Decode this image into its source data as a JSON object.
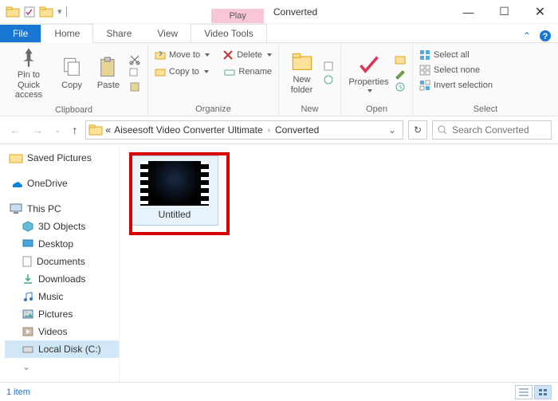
{
  "window": {
    "title": "Converted",
    "contextual_tab": "Play"
  },
  "tabs": {
    "file": "File",
    "home": "Home",
    "share": "Share",
    "view": "View",
    "video_tools": "Video Tools"
  },
  "ribbon": {
    "clipboard": {
      "pin": "Pin to Quick\naccess",
      "copy": "Copy",
      "paste": "Paste",
      "label": "Clipboard"
    },
    "organize": {
      "move": "Move to",
      "copyto": "Copy to",
      "delete": "Delete",
      "rename": "Rename",
      "label": "Organize"
    },
    "new": {
      "newfolder": "New\nfolder",
      "label": "New"
    },
    "open": {
      "properties": "Properties",
      "label": "Open"
    },
    "select": {
      "all": "Select all",
      "none": "Select none",
      "invert": "Invert selection",
      "label": "Select"
    }
  },
  "address": {
    "prefix": "«",
    "crumb1": "Aiseesoft Video Converter Ultimate",
    "crumb2": "Converted"
  },
  "search": {
    "placeholder": "Search Converted"
  },
  "nav": {
    "saved": "Saved Pictures",
    "onedrive": "OneDrive",
    "thispc": "This PC",
    "objects3d": "3D Objects",
    "desktop": "Desktop",
    "documents": "Documents",
    "downloads": "Downloads",
    "music": "Music",
    "pictures": "Pictures",
    "videos": "Videos",
    "localdisk": "Local Disk (C:)"
  },
  "file": {
    "name": "Untitled"
  },
  "status": {
    "text": "1 item"
  }
}
